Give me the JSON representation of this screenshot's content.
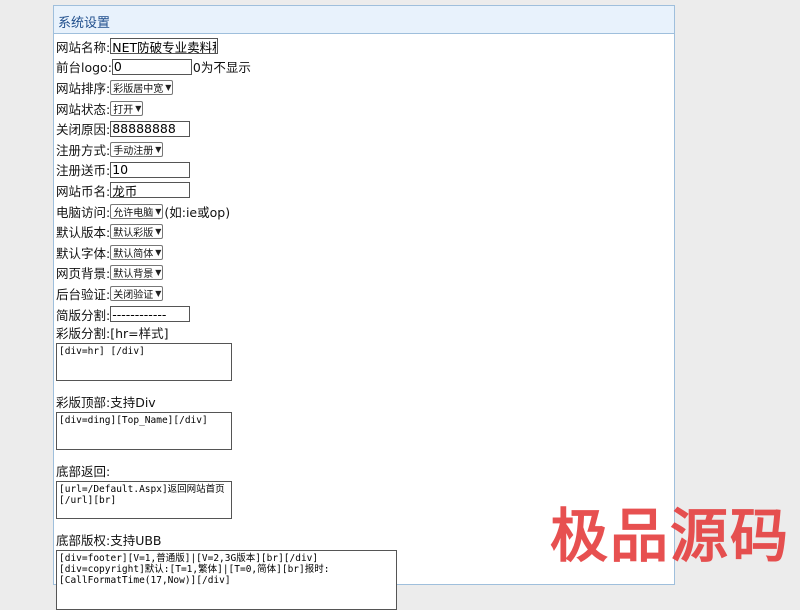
{
  "panel": {
    "title": "系统设置"
  },
  "fields": {
    "site_name": {
      "label": "网站名称:",
      "value": "NET防破专业卖料程序"
    },
    "logo": {
      "label": "前台logo:",
      "value": "0",
      "hint": "0为不显示"
    },
    "sort": {
      "label": "网站排序:",
      "selected": "彩版居中宽"
    },
    "status": {
      "label": "网站状态:",
      "selected": "打开"
    },
    "close_reason": {
      "label": "关闭原因:",
      "value": "88888888"
    },
    "register_mode": {
      "label": "注册方式:",
      "selected": "手动注册"
    },
    "register_bonus": {
      "label": "注册送币:",
      "value": "10"
    },
    "currency_name": {
      "label": "网站币名:",
      "value": "龙币"
    },
    "pc_access": {
      "label": "电脑访问:",
      "selected": "允许电脑",
      "hint": "(如:ie或op)"
    },
    "default_version": {
      "label": "默认版本:",
      "selected": "默认彩版"
    },
    "default_font": {
      "label": "默认字体:",
      "selected": "默认简体"
    },
    "page_bg": {
      "label": "网页背景:",
      "selected": "默认背景"
    },
    "admin_verify": {
      "label": "后台验证:",
      "selected": "关闭验证"
    },
    "simple_divider": {
      "label": "简版分割:",
      "value": "------------"
    },
    "color_divider": {
      "label": "彩版分割:[hr=样式]",
      "value": "[div=hr] [/div]"
    },
    "color_top": {
      "label": "彩版顶部:支持Div",
      "value": "[div=ding][Top_Name][/div]"
    },
    "footer_return": {
      "label": "底部返回:",
      "value": "[url=/Default.Aspx]返回网站首页[/url][br]"
    },
    "footer_copyright": {
      "label": "底部版权:支持UBB",
      "value": "[div=footer][V=1,普通版]|[V=2,3G版本][br][/div][div=copyright]默认:[T=1,繁体]|[T=0,简体][br]报时:[CallFormatTime(17,Now)][/div]"
    }
  },
  "watermark": {
    "text": "极品源码",
    "color": "#e54242"
  },
  "colors": {
    "header_bg": "#e8f2fc",
    "header_text": "#1f4e8c",
    "border": "#9fbfdc"
  }
}
